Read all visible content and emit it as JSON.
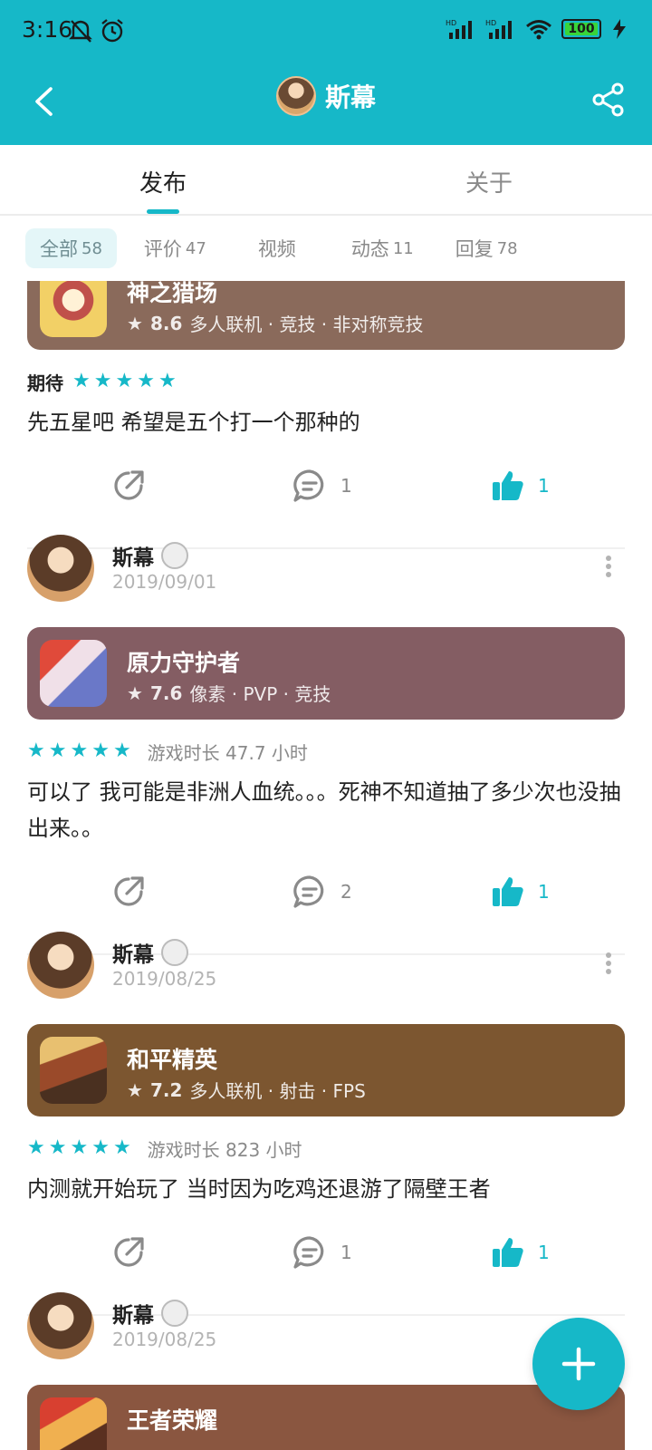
{
  "status": {
    "time": "3:16",
    "battery": "100"
  },
  "header": {
    "title": "斯幕"
  },
  "tabs": [
    {
      "label": "发布"
    },
    {
      "label": "关于"
    }
  ],
  "filters": [
    {
      "label": "全部",
      "count": "58"
    },
    {
      "label": "评价",
      "count": "47"
    },
    {
      "label": "视频",
      "count": ""
    },
    {
      "label": "动态",
      "count": "11"
    },
    {
      "label": "回复",
      "count": "78"
    }
  ],
  "posts": [
    {
      "game": {
        "name": "神之猎场",
        "score": "8.6",
        "tags": "多人联机 · 竞技 · 非对称竞技",
        "color": "#8a6a5b"
      },
      "rating_label": "期待",
      "stars": 5,
      "review": "先五星吧 希望是五个打一个那种的",
      "comments": "1",
      "likes": "1"
    },
    {
      "user": {
        "name": "斯幕",
        "date": "2019/09/01"
      },
      "game": {
        "name": "原力守护者",
        "score": "7.6",
        "tags": "像素 · PVP · 竞技",
        "color": "#845d63"
      },
      "stars": 5,
      "playtime": "游戏时长 47.7 小时",
      "review": "可以了 我可能是非洲人血统。。。死神不知道抽了多少次也没抽出来。。",
      "comments": "2",
      "likes": "1"
    },
    {
      "user": {
        "name": "斯幕",
        "date": "2019/08/25"
      },
      "game": {
        "name": "和平精英",
        "score": "7.2",
        "tags": "多人联机 · 射击 · FPS",
        "color": "#7c5630"
      },
      "stars": 5,
      "playtime": "游戏时长 823 小时",
      "review": "内测就开始玩了 当时因为吃鸡还退游了隔壁王者",
      "comments": "1",
      "likes": "1"
    },
    {
      "user": {
        "name": "斯幕",
        "date": "2019/08/25"
      },
      "game": {
        "name": "王者荣耀",
        "color": "#8a5640"
      }
    }
  ]
}
